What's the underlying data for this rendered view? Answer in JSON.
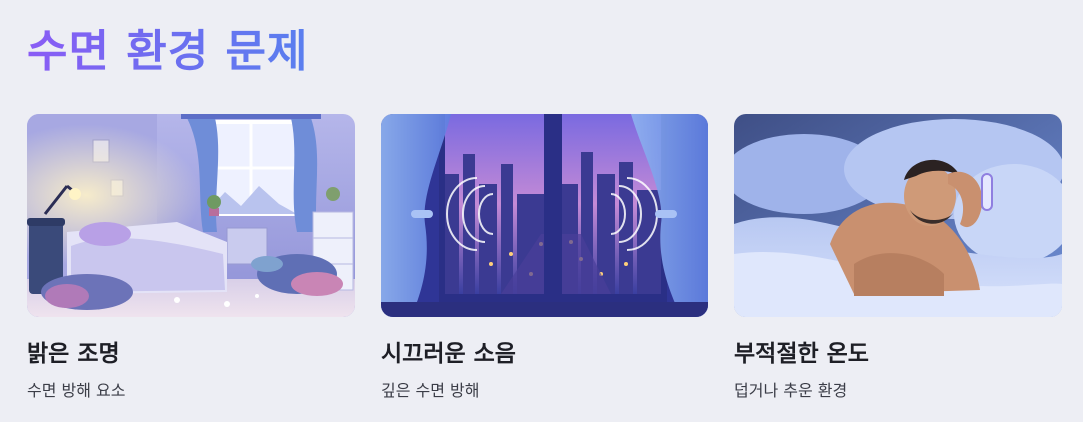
{
  "section": {
    "title": "수면 환경 문제"
  },
  "cards": [
    {
      "title": "밝은 조명",
      "description": "수면 방해 요소",
      "image_subject": "messy-bright-bedroom"
    },
    {
      "title": "시끄러운 소음",
      "description": "깊은 수면 방해",
      "image_subject": "noisy-city-window"
    },
    {
      "title": "부적절한 온도",
      "description": "덥거나 추운 환경",
      "image_subject": "uncomfortable-sleeper"
    }
  ],
  "colors": {
    "background": "#edeef4",
    "title_gradient_start": "#8a5cf5",
    "title_gradient_end": "#5a7fef",
    "text": "#1e1f26"
  }
}
